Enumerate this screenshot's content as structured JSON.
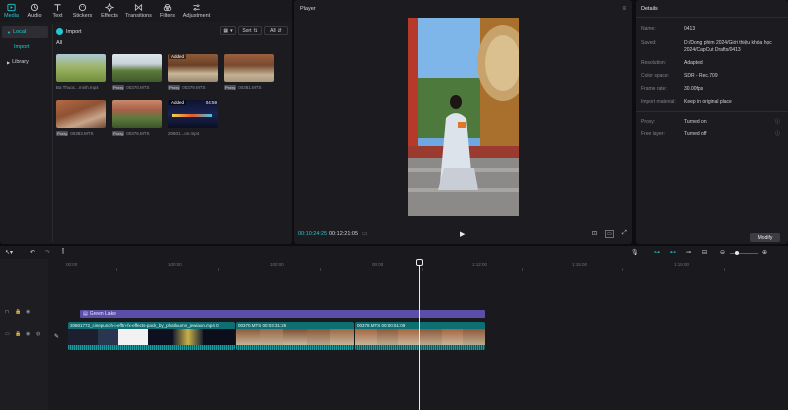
{
  "toolbar": {
    "tabs": [
      {
        "label": "Media",
        "icon": "media-icon",
        "active": true
      },
      {
        "label": "Audio",
        "icon": "audio-icon"
      },
      {
        "label": "Text",
        "icon": "text-icon"
      },
      {
        "label": "Stickers",
        "icon": "stickers-icon"
      },
      {
        "label": "Effects",
        "icon": "effects-icon"
      },
      {
        "label": "Transitions",
        "icon": "transitions-icon"
      },
      {
        "label": "Filters",
        "icon": "filters-icon"
      },
      {
        "label": "Adjustment",
        "icon": "adjustment-icon"
      }
    ]
  },
  "sidebar": {
    "items": [
      {
        "label": "Local",
        "active": true
      },
      {
        "label": "Import",
        "sub": true
      },
      {
        "label": "Library"
      }
    ]
  },
  "media": {
    "import_label": "Import",
    "sort_label": "Sort",
    "all_label": "All",
    "filter_label": "All",
    "items": [
      {
        "name": "Ba Thuoc...minh.mp4",
        "badge": "",
        "duration": "",
        "proxy": false
      },
      {
        "name": "00370.MTS",
        "badge": "",
        "duration": "",
        "proxy": true
      },
      {
        "name": "00379.MTS",
        "badge": "Added",
        "duration": "",
        "proxy": true
      },
      {
        "name": "00381.MTS",
        "badge": "",
        "duration": "",
        "proxy": true
      },
      {
        "name": "00383.MTS",
        "badge": "",
        "duration": "",
        "proxy": true
      },
      {
        "name": "00376.MTS",
        "badge": "",
        "duration": "",
        "proxy": true
      },
      {
        "name": "20601...on.mp4",
        "badge": "Added",
        "duration": "04:59",
        "proxy": false
      }
    ]
  },
  "player": {
    "title": "Player",
    "time_current": "00:10:24:25",
    "time_total": "00:12:21:05"
  },
  "details": {
    "title": "Details",
    "rows": [
      {
        "label": "Name:",
        "value": "0413"
      },
      {
        "label": "Saved:",
        "value": "D:/Dong phim 2024/Giới thiệu khóa học 2024/CapCut Drafts/0413"
      },
      {
        "label": "Resolution:",
        "value": "Adapted"
      },
      {
        "label": "Color space:",
        "value": "SDR - Rec.709"
      },
      {
        "label": "Frame rate:",
        "value": "30.00fps"
      },
      {
        "label": "Import material:",
        "value": "Keep in original place"
      },
      {
        "label": "Proxy:",
        "value": "Turned on"
      },
      {
        "label": "Free layer:",
        "value": "Turned off"
      }
    ],
    "modify_label": "Modify"
  },
  "timeline": {
    "ticks": [
      "00:00",
      "100:00",
      "100:00",
      "00:00",
      "1:12:00",
      "1:15:00",
      "1:15:00"
    ],
    "text_clip": "Green Lake",
    "clips": [
      {
        "label": "20601772_cinepunch-i-efftn-fx-effects-pack_by_phatluumn_jewiaon.mp4  0"
      },
      {
        "label": "00370.MTS  00:03:31:25"
      },
      {
        "label": "00378.MTS  00:00:51:09"
      }
    ]
  },
  "colors": {
    "accent": "#23c7cf",
    "panel": "#1c1c20",
    "text_track": "#5b4ea8",
    "video_track": "#0e6f72"
  }
}
